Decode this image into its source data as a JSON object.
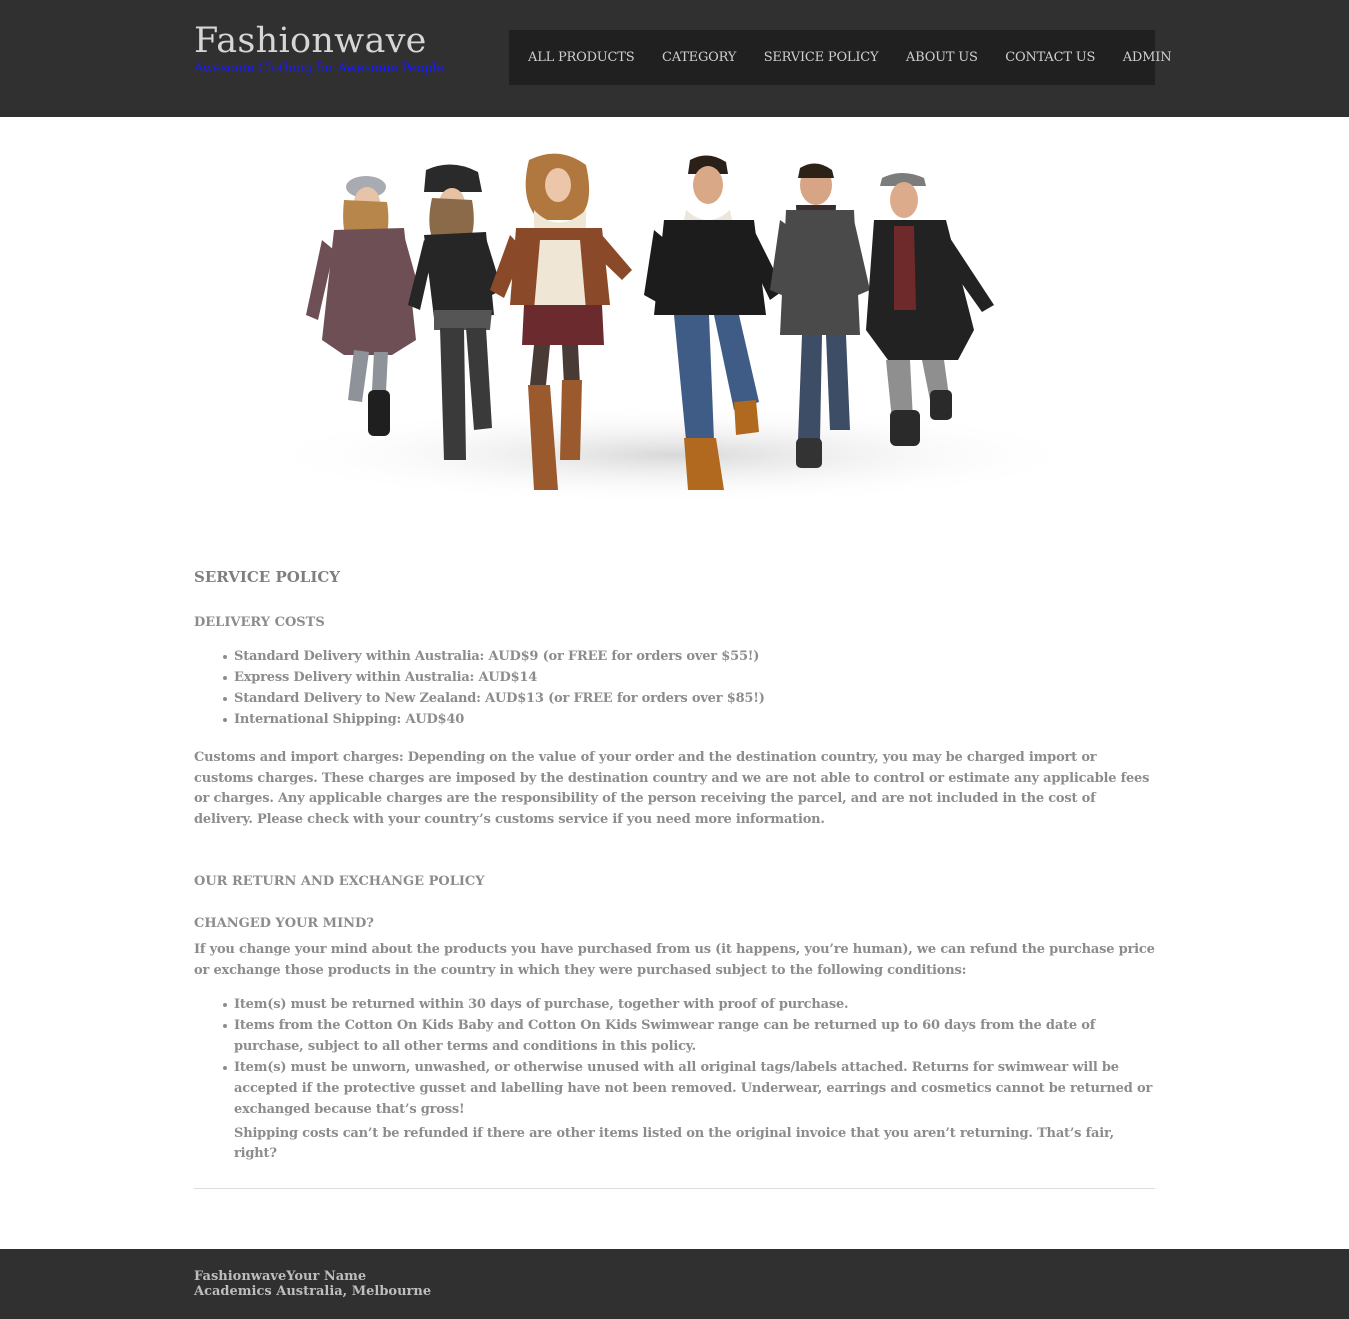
{
  "brand": {
    "name": "Fashionwave",
    "tagline": "Awesome Clothing for Awesome People"
  },
  "nav": {
    "items": [
      "ALL PRODUCTS",
      "CATEGORY",
      "SERVICE POLICY",
      "ABOUT US",
      "CONTACT US",
      "ADMIN"
    ]
  },
  "colors": {
    "header_bg": "#303030",
    "nav_bg": "#202020",
    "tagline": "#1a1aff",
    "text": "#8c8c8c"
  },
  "main": {
    "title": "SERVICE POLICY",
    "delivery": {
      "heading": "DELIVERY COSTS",
      "items": [
        "Standard Delivery within Australia: AUD$9 (or FREE for orders over $55!)",
        "Express Delivery within Australia: AUD$14",
        "Standard Delivery to New Zealand: AUD$13 (or FREE for orders over $85!)",
        "International Shipping: AUD$40"
      ],
      "customs": "Customs and import charges: Depending on the value of your order and the destination country, you may be charged import or customs charges. These charges are imposed by the destination country and we are not able to control or estimate any applicable fees or charges. Any applicable charges are the responsibility of the person receiving the parcel, and are not included in the cost of delivery. Please check with your country’s customs service if you need more information."
    },
    "returns": {
      "heading": "OUR RETURN AND EXCHANGE POLICY",
      "subheading": "CHANGED YOUR MIND?",
      "intro": "If you change your mind about the products you have purchased from us (it happens, you’re human), we can refund the purchase price or exchange those products in the country in which they were purchased subject to the following conditions:",
      "items": [
        "Item(s) must be returned within 30 days of purchase, together with proof of purchase.",
        "Items from the Cotton On Kids Baby and Cotton On Kids Swimwear range can be returned up to 60 days from the date of purchase, subject to all other terms and conditions in this policy.",
        "Item(s) must be unworn, unwashed, or otherwise unused with all original tags/labels attached. Returns for swimwear will be accepted if the protective gusset and labelling have not been removed. Underwear, earrings and cosmetics cannot be returned or exchanged because that’s gross!"
      ],
      "note": "Shipping costs can’t be refunded if there are other items listed on the original invoice that you aren’t returning. That’s fair, right?"
    }
  },
  "footer": {
    "line1": "FashionwaveYour Name",
    "line2": "Academics Australia, Melbourne"
  }
}
